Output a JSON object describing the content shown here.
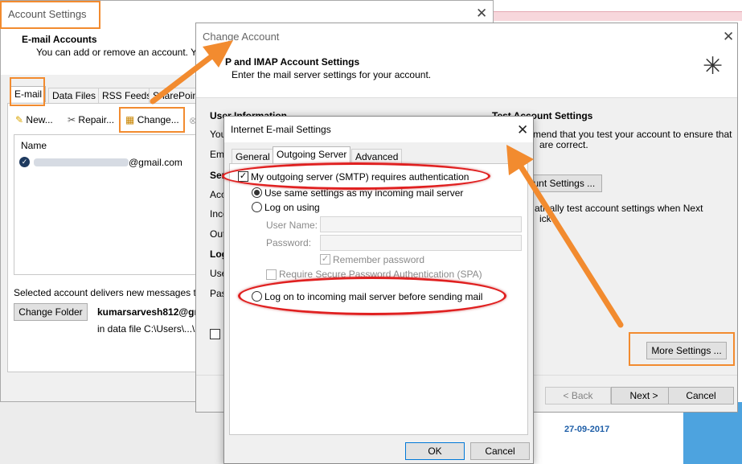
{
  "account_settings": {
    "title": "Account Settings",
    "heading": "E-mail Accounts",
    "subheading": "You can add or remove an account. You",
    "tabs": [
      "E-mail",
      "Data Files",
      "RSS Feeds",
      "SharePoint"
    ],
    "toolbar": {
      "new": "New...",
      "repair": "Repair...",
      "change": "Change..."
    },
    "list_header": "Name",
    "account_suffix": "@gmail.com",
    "delivers_text": "Selected account delivers new messages to t",
    "change_folder": "Change Folder",
    "account_email": "kumarsarvesh812@gma",
    "data_file": "in data file C:\\Users\\...\\C"
  },
  "change_account": {
    "title": "Change Account",
    "heading": "P and IMAP Account Settings",
    "subheading": "Enter the mail server settings for your account.",
    "user_info": "User Information",
    "left_labels": [
      "You",
      "Ema",
      "Serv",
      "Acc",
      "Inco",
      "Out",
      "Log",
      "Use",
      "Pas"
    ],
    "test_heading": "Test Account Settings",
    "test_text_1": "mend that you test your account to ensure that",
    "test_text_2": "are correct.",
    "test_button": "ount Settings ...",
    "auto_text_1": "atically test account settings when Next",
    "auto_text_2": "ick",
    "more_settings": "More Settings ...",
    "back": "< Back",
    "next": "Next >",
    "cancel": "Cancel"
  },
  "internet_settings": {
    "title": "Internet E-mail Settings",
    "tabs": [
      "General",
      "Outgoing Server",
      "Advanced"
    ],
    "smtp_auth": "My outgoing server (SMTP) requires authentication",
    "use_same": "Use same settings as my incoming mail server",
    "log_on_using": "Log on using",
    "user_name": "User Name:",
    "password": "Password:",
    "remember_password": "Remember password",
    "require_spa": "Require Secure Password Authentication (SPA)",
    "log_on_incoming": "Log on to incoming mail server before sending mail",
    "ok": "OK",
    "cancel": "Cancel"
  },
  "background": {
    "date": "27-09-2017"
  },
  "colors": {
    "annotation_orange": "#f28b2f",
    "annotation_red": "#e02020",
    "link_blue": "#1f5fa8"
  }
}
